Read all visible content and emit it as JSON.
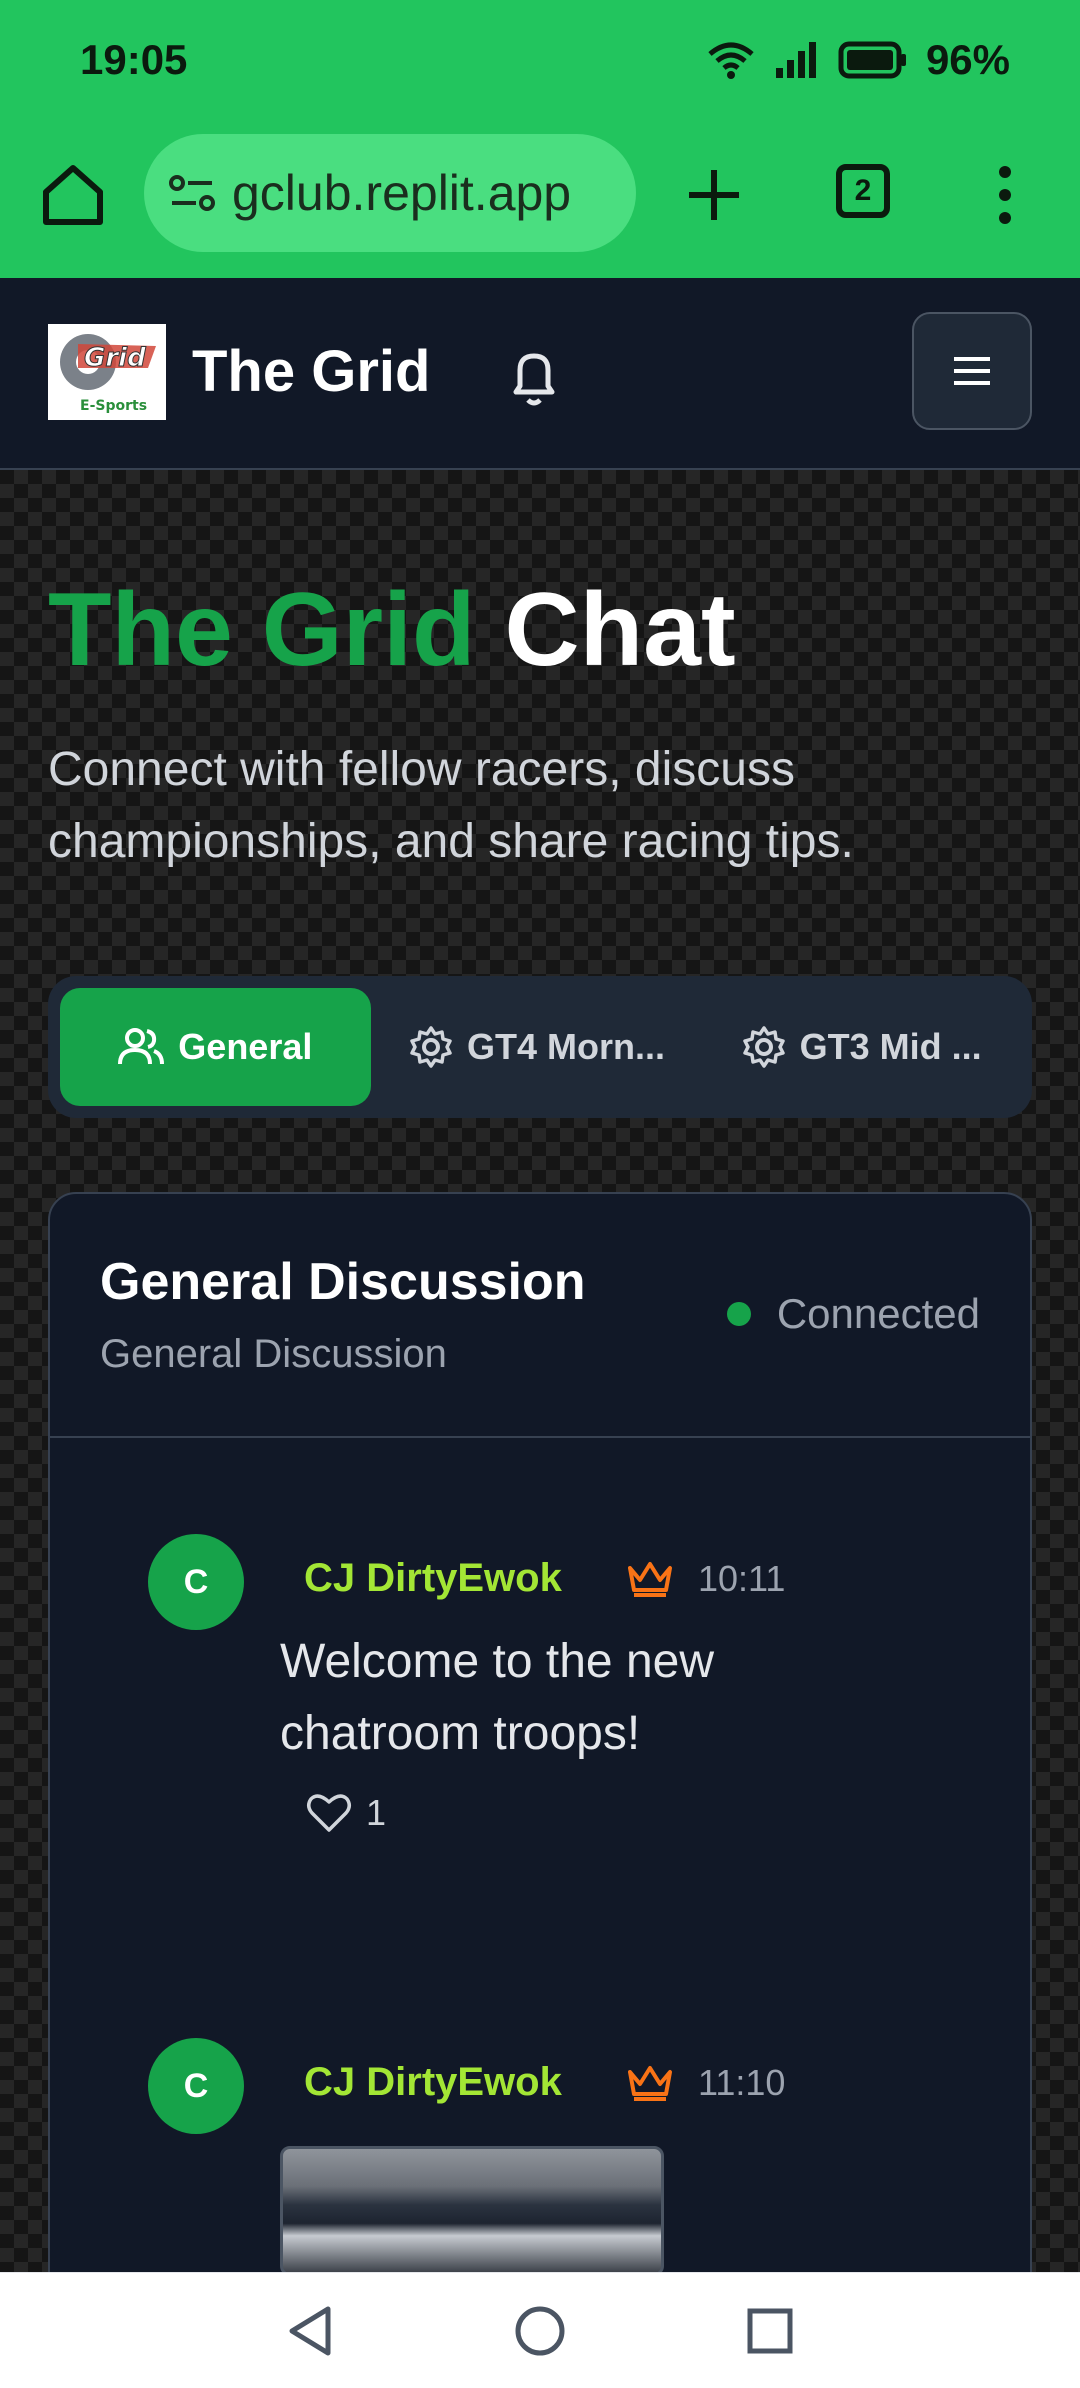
{
  "status_bar": {
    "time": "19:05",
    "battery": "96%"
  },
  "browser": {
    "url": "gclub.replit.app",
    "tab_count": "2"
  },
  "nav": {
    "title": "The Grid",
    "logo_label": "E-Sports"
  },
  "hero": {
    "title_accent": "The Grid",
    "title_rest": "Chat",
    "subtitle": "Connect with fellow racers, discuss championships, and share racing tips."
  },
  "tabs": [
    {
      "label": "General",
      "icon": "users-icon",
      "active": true
    },
    {
      "label": "GT4 Morn...",
      "icon": "gear-icon",
      "active": false
    },
    {
      "label": "GT3 Mid ...",
      "icon": "gear-icon",
      "active": false
    }
  ],
  "chat": {
    "title": "General Discussion",
    "subtitle": "General Discussion",
    "status": "Connected",
    "messages": [
      {
        "avatar": "C",
        "author": "CJ DirtyEwok",
        "time": "10:11",
        "text": "Welcome to the new chatroom troops!",
        "likes": "1"
      },
      {
        "avatar": "C",
        "author": "CJ DirtyEwok",
        "time": "11:10"
      }
    ]
  },
  "colors": {
    "accent": "#16a34a",
    "browser": "#22c55e",
    "author": "#a3e635",
    "crown": "#f97316",
    "bg": "#111827"
  }
}
